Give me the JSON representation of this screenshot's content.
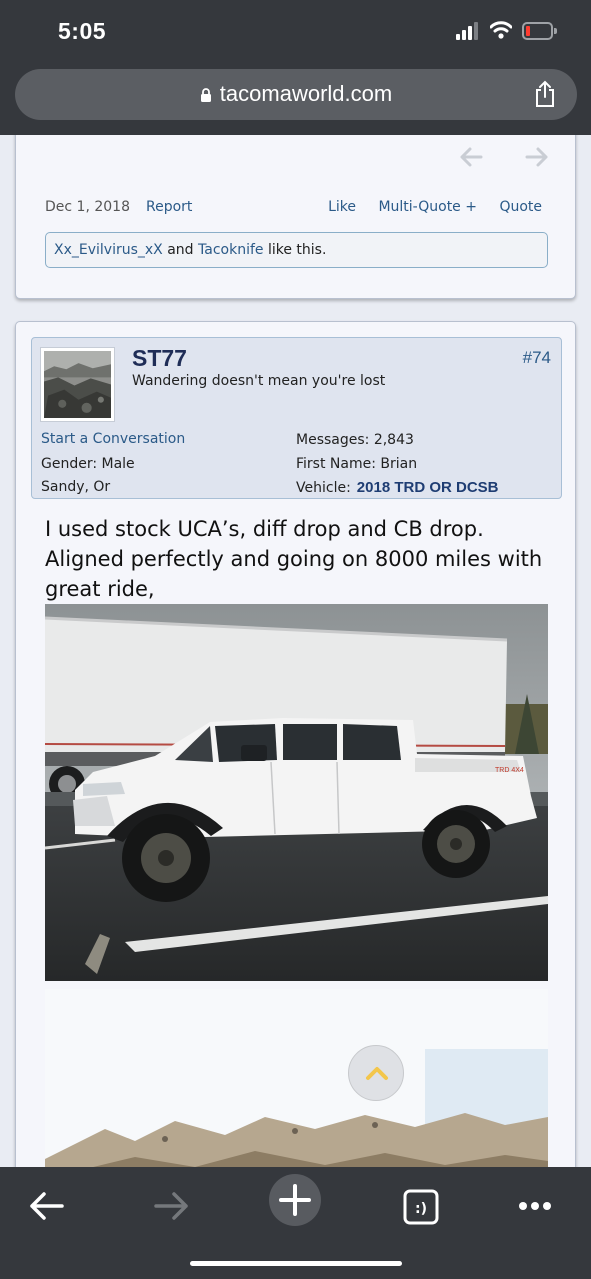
{
  "status_bar": {
    "time": "5:05"
  },
  "browser": {
    "url": "tacomaworld.com"
  },
  "previous_post": {
    "date": "Dec 1, 2018",
    "report_label": "Report",
    "actions": [
      "Like",
      "Multi-Quote +",
      "Quote"
    ],
    "likes": {
      "user1": "Xx_Evilvirus_xX",
      "joiner": "and",
      "user2": "Tacoknife",
      "suffix": "like this."
    }
  },
  "post": {
    "username": "ST77",
    "user_title": "Wandering doesn't mean you're lost",
    "post_number": "#74",
    "start_conversation": "Start a Conversation",
    "gender": "Gender: Male",
    "location": "Sandy, Or",
    "messages": "Messages: 2,843",
    "first_name": "First Name: Brian",
    "vehicle_label": "Vehicle:",
    "vehicle_value": "2018 TRD OR DCSB",
    "body": "I used stock UCA’s, diff drop and CB drop. Aligned perfectly and going on 8000 miles with great ride,",
    "photo_truck_badge": "TRD 4X4"
  },
  "toolbar": {
    "icons": [
      "back-arrow-icon",
      "forward-arrow-icon",
      "plus-icon",
      "tabs-icon",
      "more-dots-icon"
    ],
    "tabs_glyph": ":)"
  },
  "colors": {
    "chrome": "#35383d",
    "link": "#2b5a88",
    "userinfo_bg": "#dfe4ef",
    "title_navy": "#1f2d57"
  }
}
